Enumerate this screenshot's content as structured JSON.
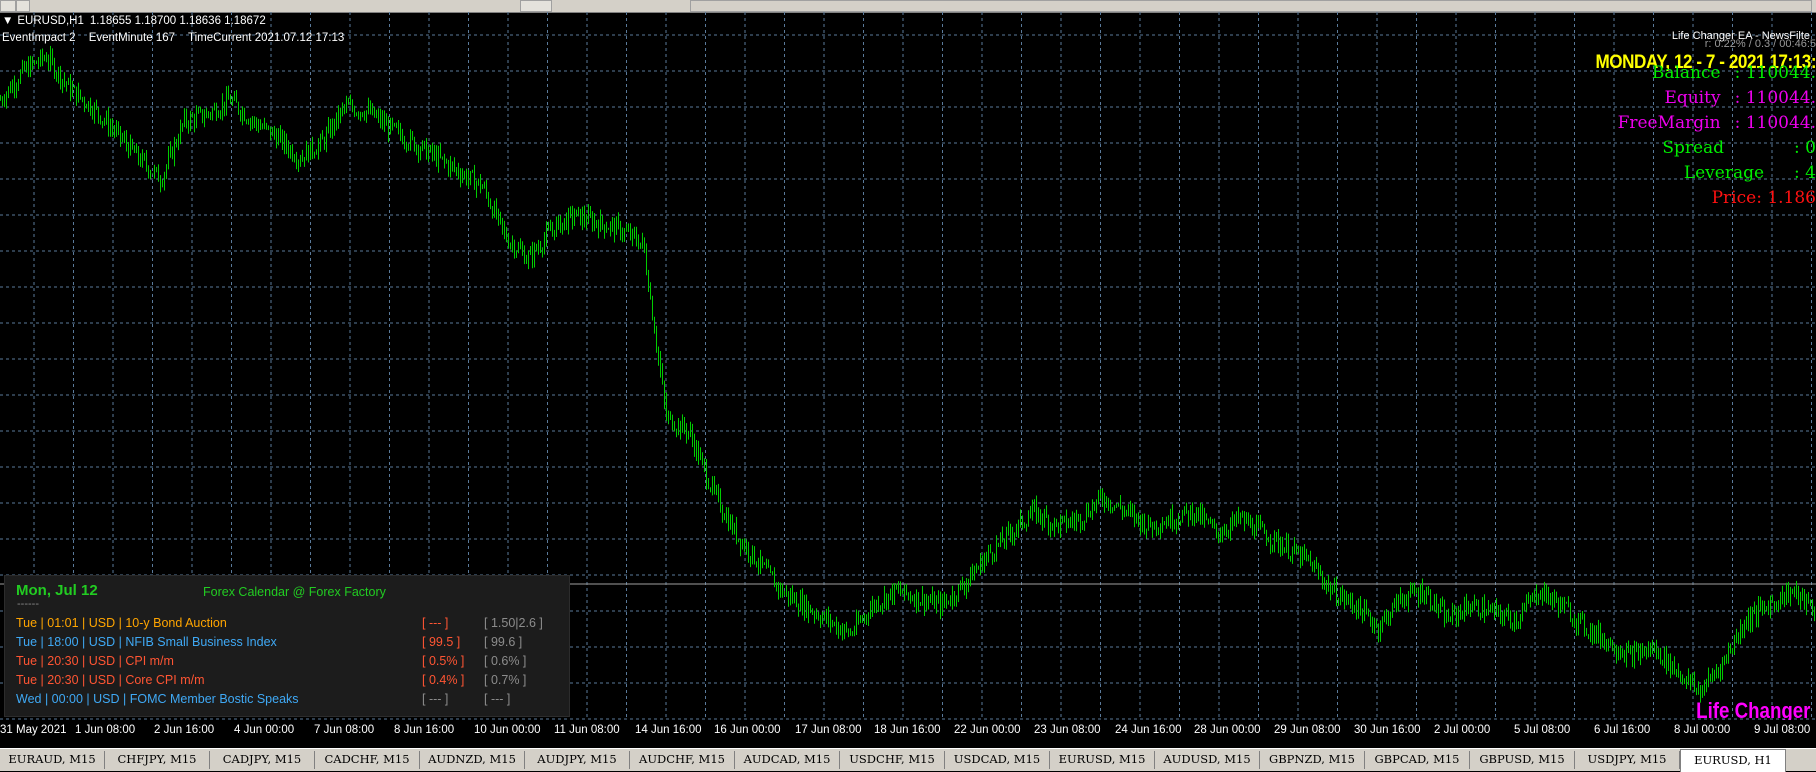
{
  "symbol_info": {
    "title": "EURUSD,H1",
    "ohlc": "1.18655 1.18700 1.18636 1.18672",
    "event_impact": "EventImpact  2",
    "event_minute": "EventMinute  167",
    "time_current": "TimeCurrent  2021.07.12 17:13"
  },
  "ea_panel": {
    "name": "Life Changer EA - NewsFilte",
    "subline": "r: 0.22% / 0.3 / 00:46:5",
    "date_header": "MONDAY, 12 - 7 - 2021 17:13:",
    "rows": [
      {
        "label": "Balance",
        "value": ": 110044.",
        "color": "#00ee00"
      },
      {
        "label": "Equity",
        "value": ": 110044.",
        "color": "#ee00ee"
      },
      {
        "label": "FreeMargin",
        "value": ": 110044.",
        "color": "#ee00ee"
      },
      {
        "label": "Spread",
        "value": ": 0",
        "color": "#00ee00"
      },
      {
        "label": "Leverage",
        "value": ": 4",
        "color": "#00ee00"
      },
      {
        "label": "Price",
        "value": ": 1.186",
        "color": "#ff1111"
      }
    ],
    "logo_text": "Life Changer"
  },
  "calendar": {
    "date": "Mon, Jul 12",
    "title": "Forex Calendar @ Forex Factory",
    "separator": "------",
    "events": [
      {
        "text": "Tue  |  01:01  |  USD  |  10-y Bond Auction",
        "actual": "[ --- ]",
        "forecast": "[ 1.50|2.6 ]",
        "color": "#ffa500"
      },
      {
        "text": "Tue  |  18:00  |  USD  |  NFIB Small Business Index",
        "actual": "[ 99.5 ]",
        "forecast": "[ 99.6 ]",
        "color": "#3fa9f5"
      },
      {
        "text": "Tue  |  20:30  |  USD  |  CPI m/m",
        "actual": "[ 0.5% ]",
        "forecast": "[ 0.6% ]",
        "color": "#ff5533"
      },
      {
        "text": "Tue  |  20:30  |  USD  |  Core CPI m/m",
        "actual": "[ 0.4% ]",
        "forecast": "[ 0.7% ]",
        "color": "#ff5533"
      },
      {
        "text": "Wed  |  00:00  |  USD  |  FOMC Member Bostic Speaks",
        "actual": "[ --- ]",
        "forecast": "[ --- ]",
        "color": "#3fa9f5"
      }
    ]
  },
  "x_axis_labels": [
    "31 May 2021",
    "1 Jun 08:00",
    "2 Jun 16:00",
    "4 Jun 00:00",
    "7 Jun 08:00",
    "8 Jun 16:00",
    "10 Jun 00:00",
    "11 Jun 08:00",
    "14 Jun 16:00",
    "16 Jun 00:00",
    "17 Jun 08:00",
    "18 Jun 16:00",
    "22 Jun 00:00",
    "23 Jun 08:00",
    "24 Jun 16:00",
    "28 Jun 00:00",
    "29 Jun 08:00",
    "30 Jun 16:00",
    "2 Jul 00:00",
    "5 Jul 08:00",
    "6 Jul 16:00",
    "8 Jul 00:00",
    "9 Jul 08:00"
  ],
  "tabs": [
    "EURAUD, M15",
    "CHFJPY, M15",
    "CADJPY, M15",
    "CADCHF, M15",
    "AUDNZD, M15",
    "AUDJPY, M15",
    "AUDCHF, M15",
    "AUDCAD, M15",
    "USDCHF, M15",
    "USDCAD, M15",
    "EURUSD, M15",
    "AUDUSD, M15",
    "GBPNZD, M15",
    "GBPCAD, M15",
    "GBPUSD, M15",
    "USDJPY, M15",
    "EURUSD, H1"
  ],
  "active_tab": 16,
  "colors": {
    "background": "#000000",
    "grid": "#5a7a9a",
    "bars": "#00cc00",
    "bid_line": "#a0a0a0"
  },
  "chart_data": {
    "type": "line",
    "symbol": "EURUSD",
    "timeframe": "H1",
    "x_start": "31 May 2021",
    "x_end": "9 Jul 08:00",
    "y_approx": [
      1.222,
      1.224,
      1.225,
      1.2228,
      1.2215,
      1.2198,
      1.218,
      1.2165,
      1.2205,
      1.221,
      1.222,
      1.2205,
      1.2195,
      1.218,
      1.219,
      1.2215,
      1.2212,
      1.22,
      1.219,
      1.218,
      1.217,
      1.216,
      1.2125,
      1.211,
      1.213,
      1.214,
      1.2135,
      1.213,
      1.212,
      1.2,
      1.199,
      1.195,
      1.192,
      1.19,
      1.188,
      1.187,
      1.186,
      1.185,
      1.187,
      1.188,
      1.1875,
      1.187,
      1.1885,
      1.1905,
      1.192,
      1.1935,
      1.1925,
      1.193,
      1.1945,
      1.1935,
      1.1925,
      1.193,
      1.1935,
      1.192,
      1.193,
      1.192,
      1.191,
      1.19,
      1.188,
      1.187,
      1.1855,
      1.1875,
      1.188,
      1.186,
      1.187,
      1.1865,
      1.186,
      1.188,
      1.187,
      1.1855,
      1.1845,
      1.1835,
      1.184,
      1.1825,
      1.181,
      1.183,
      1.186,
      1.187,
      1.188,
      1.1867
    ]
  }
}
